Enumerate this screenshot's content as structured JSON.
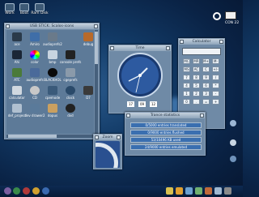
{
  "desktop": {
    "icons": [
      {
        "label": "Work"
      },
      {
        "label": "Boot"
      },
      {
        "label": "Ram Disk"
      }
    ]
  },
  "menubar": {
    "con_label": "CON 22"
  },
  "usb": {
    "title": "USB STICK: Scalos-icons",
    "items": [
      "ace",
      "Amiro",
      "audioprefs2",
      "",
      "debug",
      "Ahi",
      "color",
      "bmp",
      "console prefs",
      "",
      "ATC",
      "audioprefs",
      "BLACKHOL",
      "cgeprefs",
      "",
      "calculator",
      "CD",
      "cpemode",
      "clock",
      "D7",
      "def_project",
      "dev drawer2",
      "dopus",
      "dvd",
      ""
    ]
  },
  "clock": {
    "title": "Time",
    "fields": [
      "17",
      "09",
      "12"
    ]
  },
  "calculator": {
    "title": "Calculator",
    "buttons": [
      [
        "MC",
        "MR",
        "M+",
        "M-"
      ],
      [
        "MS",
        "AC",
        "C",
        "+/-"
      ],
      [
        "7",
        "8",
        "9",
        "/"
      ],
      [
        "4",
        "5",
        "6",
        "*"
      ],
      [
        "1",
        "2",
        "3",
        "-"
      ],
      [
        "0",
        ".",
        "=",
        "+"
      ]
    ]
  },
  "trance": {
    "title": "Trance statistics",
    "rows": [
      "0/5000 entries translated",
      "0/9000 entries flushed",
      "53/10496 KB used",
      "24/9000 entries emulated"
    ]
  },
  "zoom": {
    "title": "Zoom"
  }
}
